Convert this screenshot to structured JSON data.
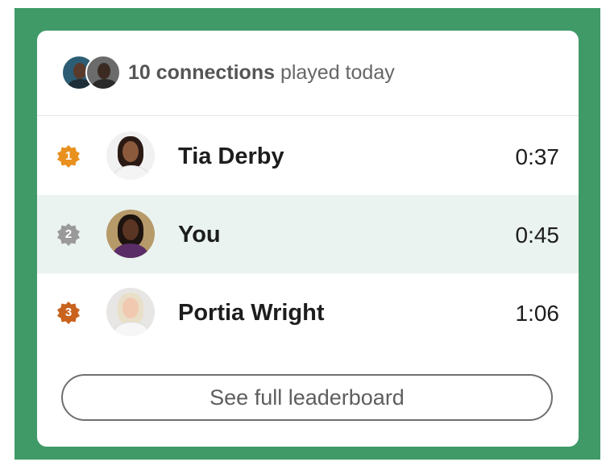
{
  "header": {
    "connections_bold": "10 connections",
    "connections_rest": " played today"
  },
  "leaderboard": [
    {
      "rank": "1",
      "name": "Tia Derby",
      "time": "0:37",
      "badge_color": "#e8911f",
      "highlighted": false
    },
    {
      "rank": "2",
      "name": "You",
      "time": "0:45",
      "badge_color": "#9a9a9a",
      "highlighted": true
    },
    {
      "rank": "3",
      "name": "Portia Wright",
      "time": "1:06",
      "badge_color": "#c8621c",
      "highlighted": false
    }
  ],
  "button": {
    "label": "See full leaderboard"
  },
  "colors": {
    "background_green": "#3f9a67",
    "highlight_row": "#eaf3f0"
  }
}
